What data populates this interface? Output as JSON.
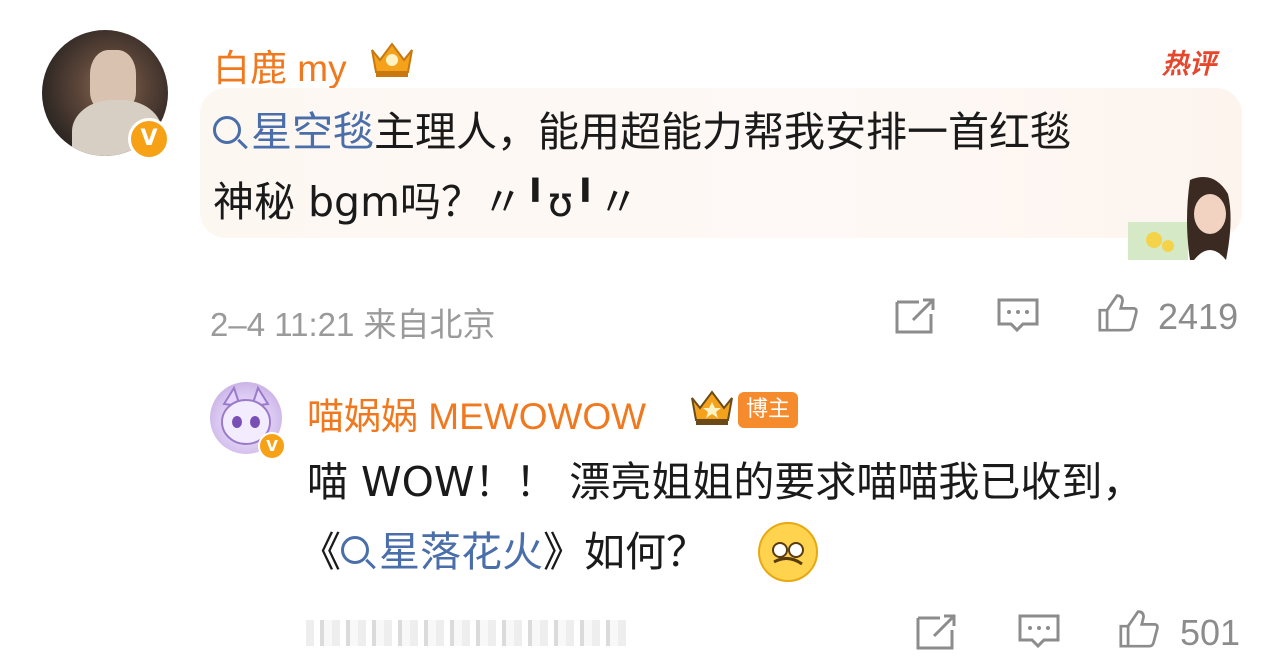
{
  "main_comment": {
    "username": "白鹿 my",
    "hot_label": "热评",
    "text_line1_topic": "星空毯",
    "text_line1_rest": "主理人，能用超能力帮我安排一首红毯",
    "text_line2": "神秘 bgm吗？〃╹ʊ╹〃",
    "timestamp": "2–4 11:21",
    "location": "来自北京",
    "like_count": "2419"
  },
  "reply": {
    "username": "喵娲娲 MEWOWOW",
    "badge": "博主",
    "text_line1": "喵 WOW！！ 漂亮姐姐的要求喵喵我已收到，",
    "text_line2_open": "《",
    "text_line2_topic": "星落花火",
    "text_line2_close": "》如何？",
    "like_count": "501"
  },
  "colors": {
    "username": "#f0781e",
    "topic_link": "#4a6ea9",
    "meta_gray": "#9a9a9a",
    "verified": "#f6a116",
    "hot": "#e5462c"
  },
  "icons": [
    "verified-icon",
    "crown-icon",
    "share-icon",
    "comment-icon",
    "like-icon",
    "search-icon",
    "facepalm-emoji"
  ]
}
